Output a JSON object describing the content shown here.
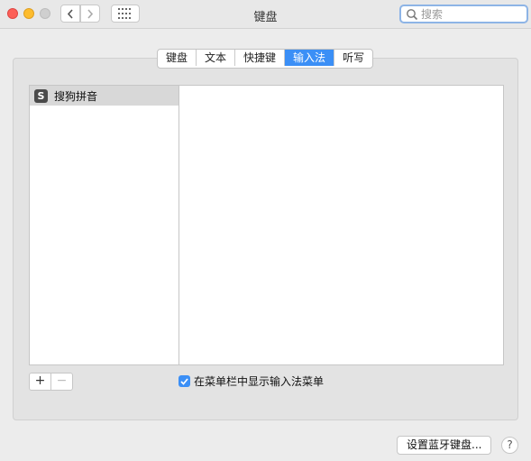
{
  "window": {
    "title": "键盘"
  },
  "toolbar": {
    "back_icon": "chevron-left-icon",
    "forward_icon": "chevron-right-icon",
    "show_all_icon": "grid-icon"
  },
  "search": {
    "placeholder": "搜索",
    "value": ""
  },
  "tabs": [
    {
      "label": "键盘",
      "active": false
    },
    {
      "label": "文本",
      "active": false
    },
    {
      "label": "快捷键",
      "active": false
    },
    {
      "label": "输入法",
      "active": true
    },
    {
      "label": "听写",
      "active": false
    }
  ],
  "input_sources": [
    {
      "icon_letter": "S",
      "label": "搜狗拼音",
      "selected": true
    }
  ],
  "list_controls": {
    "add": "+",
    "remove": "−"
  },
  "show_menu_checkbox": {
    "label": "在菜单栏中显示输入法菜单",
    "checked": true
  },
  "bluetooth_button": {
    "label": "设置蓝牙键盘..."
  },
  "help_button": {
    "label": "?"
  },
  "colors": {
    "accent": "#3b8ff6",
    "selection": "#d8d8d8"
  }
}
